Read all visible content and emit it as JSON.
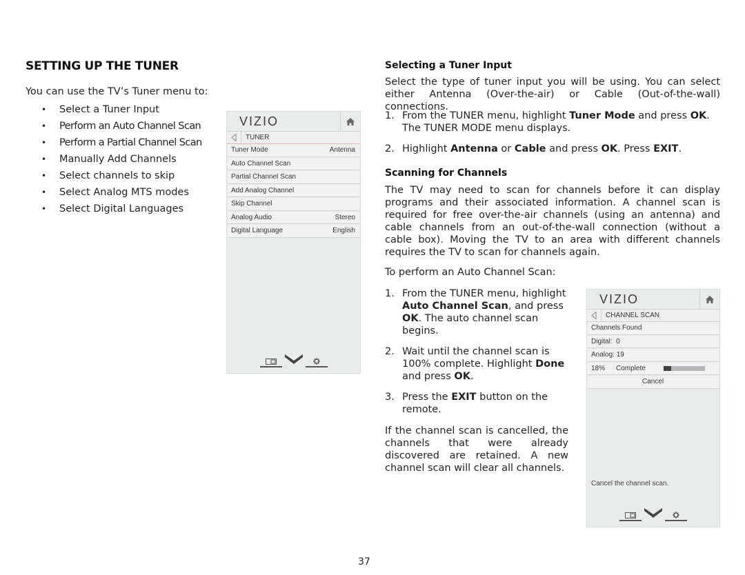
{
  "page": {
    "title": "SETTING UP THE TUNER",
    "intro": "You can use the TV’s Tuner menu to:",
    "bullets": [
      "Select a Tuner Input",
      "Perform an Auto Channel Scan",
      "Perform a Partial Channel Scan",
      "Manually Add Channels",
      "Select channels to skip",
      "Select Analog MTS modes",
      "Select Digital Languages"
    ],
    "bullet_glyph": "•",
    "page_number": "37"
  },
  "tuner_menu": {
    "logo": "VIZIO",
    "home_icon": "home-icon",
    "back_icon": "back-arrow-icon",
    "breadcrumb": "TUNER",
    "rows": [
      {
        "label": "Tuner Mode",
        "value": "Antenna"
      },
      {
        "label": "Auto Channel Scan",
        "value": ""
      },
      {
        "label": "Partial Channel Scan",
        "value": ""
      },
      {
        "label": "Add Analog Channel",
        "value": ""
      },
      {
        "label": "Skip Channel",
        "value": ""
      },
      {
        "label": "Analog Audio",
        "value": "Stereo"
      },
      {
        "label": "Digital Language",
        "value": "English"
      }
    ],
    "footer_icons": [
      "wide-screen-icon",
      "vizio-v-icon",
      "settings-gear-icon"
    ]
  },
  "selecting_input": {
    "heading": "Selecting a Tuner Input",
    "body": "Select the type of tuner input you will be using. You can select either Antenna (Over-the-air) or Cable (Out-of-the-wall) connections.",
    "steps": [
      {
        "num": "1.",
        "parts": [
          "From the TUNER menu, highlight ",
          "Tuner Mode",
          " and press ",
          "OK",
          ". The TUNER MODE menu displays."
        ]
      },
      {
        "num": "2.",
        "parts": [
          "Highlight ",
          "Antenna",
          " or ",
          "Cable",
          " and press ",
          "OK",
          ". Press ",
          "EXIT",
          "."
        ]
      }
    ]
  },
  "scanning": {
    "heading": "Scanning for Channels",
    "body": "The TV may need to scan for channels before it can display programs and their associated information. A channel scan is required for free over-the-air channels (using an antenna) and cable channels from an out-of-the-wall connection (without a cable box). Moving the TV to an area with different channels requires the TV to scan for channels again.",
    "lead": "To perform an Auto Channel Scan:",
    "steps": [
      {
        "num": "1.",
        "parts": [
          "From the TUNER menu, highlight ",
          "Auto Channel Scan",
          ", and press ",
          "OK",
          ". The auto channel scan begins."
        ]
      },
      {
        "num": "2.",
        "parts": [
          "Wait until the channel scan is 100% complete. Highlight ",
          "Done",
          " and press ",
          "OK",
          "."
        ]
      },
      {
        "num": "3.",
        "parts": [
          "Press the ",
          "EXIT",
          " button on the remote."
        ]
      }
    ],
    "note": "If the channel scan is cancelled, the channels that were already discovered are retained. A new channel scan will clear all channels."
  },
  "scan_menu": {
    "logo": "VIZIO",
    "breadcrumb": "CHANNEL SCAN",
    "channels_found_label": "Channels Found",
    "digital": "Digital:  0",
    "analog": "Analog: 19",
    "percent_label": "18%",
    "complete_label": "Complete",
    "progress_fraction": 0.18,
    "cancel_label": "Cancel",
    "help_text": "Cancel the channel scan."
  }
}
